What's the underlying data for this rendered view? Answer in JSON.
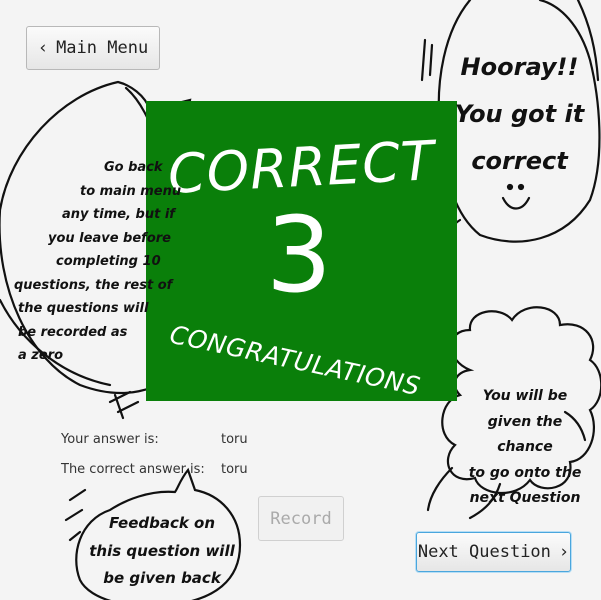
{
  "nav": {
    "main_menu_label": "Main Menu",
    "main_menu_icon": "chevron-left-icon",
    "next_question_label": "Next Question",
    "next_question_icon": "chevron-right-icon"
  },
  "result": {
    "heading": "CORRECT",
    "score": "3",
    "subheading": "CONGRATULATIONS",
    "panel_color": "#0a7f0a"
  },
  "answers": {
    "your_answer_label": "Your answer is:",
    "your_answer_value": "toru",
    "correct_answer_label": "The correct answer is:",
    "correct_answer_value": "toru"
  },
  "record_label": "Record",
  "notes": {
    "hooray_lines": [
      "Hooray!!",
      "You got it",
      "correct"
    ],
    "left_lines": [
      "Go back",
      "to main menu",
      "any time, but if",
      "you leave before",
      "completing 10",
      "questions, the rest of",
      "the  questions will",
      "be recorded as",
      "a zero"
    ],
    "next_lines": [
      "You will be",
      "given the chance",
      "to go onto the",
      "next Question"
    ],
    "feedback_lines": [
      "Feedback on",
      "this question will",
      "be given back"
    ]
  }
}
